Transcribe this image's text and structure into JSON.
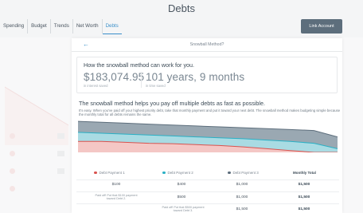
{
  "page": {
    "title": "Debts"
  },
  "nav": {
    "tabs": [
      {
        "label": "Spending",
        "active": false
      },
      {
        "label": "Budget",
        "active": false
      },
      {
        "label": "Trends",
        "active": false
      },
      {
        "label": "Net Worth",
        "active": false
      },
      {
        "label": "Debts",
        "active": true
      }
    ],
    "link_account_label": "Link Account"
  },
  "modal": {
    "title": "Snowball Method?",
    "savings": {
      "headline": "How the snowball method can work for you.",
      "interest_value": "$183,074.95",
      "interest_label": "in interest saved",
      "time_value": "101 years, 9 months",
      "time_label": "in time saved"
    },
    "explain": {
      "title": "The snowball method helps you pay off multiple debts as fast as possible.",
      "body": "It's easy. When you've paid off your highest priority debt, take that monthly payment and put it toward your next debt. The snowball method makes budgeting simple because the monthly total for all debts remains the same."
    },
    "legend": {
      "debt1": "Debt Payment 1",
      "debt2": "Debt Payment 2",
      "debt3": "Debt Payment 3",
      "total": "Monthly Total"
    },
    "rows": [
      {
        "d1": "$100",
        "d2": "$400",
        "d3": "$1,000",
        "total": "$1,500"
      },
      {
        "d1": "Paid off! Put that $100 payment toward Debt 2.",
        "d2": "$500",
        "d3": "$1,000",
        "total": "$1,500"
      },
      {
        "d1": "",
        "d2": "Paid off! Put that $500 payment toward Debt 3.",
        "d3": "$1,500",
        "total": "$1,500"
      }
    ]
  },
  "colors": {
    "debt1": "#d9534f",
    "debt2": "#2ab0c5",
    "debt3": "#5d6e7c",
    "accent": "#3a8fc9"
  },
  "chart_data": {
    "type": "area",
    "x": [
      0,
      1,
      2,
      3,
      4,
      5,
      6,
      7,
      8,
      9,
      10,
      11
    ],
    "series": [
      {
        "values": [
          12,
          12,
          11,
          10,
          9.5,
          8.5,
          7.5,
          6,
          4,
          2,
          0,
          0
        ]
      },
      {
        "values": [
          22,
          21,
          20,
          19,
          18,
          17,
          16,
          15,
          13.5,
          12,
          10,
          4
        ]
      },
      {
        "values": [
          34,
          33,
          32,
          31,
          30,
          29,
          28,
          27,
          26,
          25,
          24,
          17
        ]
      }
    ]
  }
}
